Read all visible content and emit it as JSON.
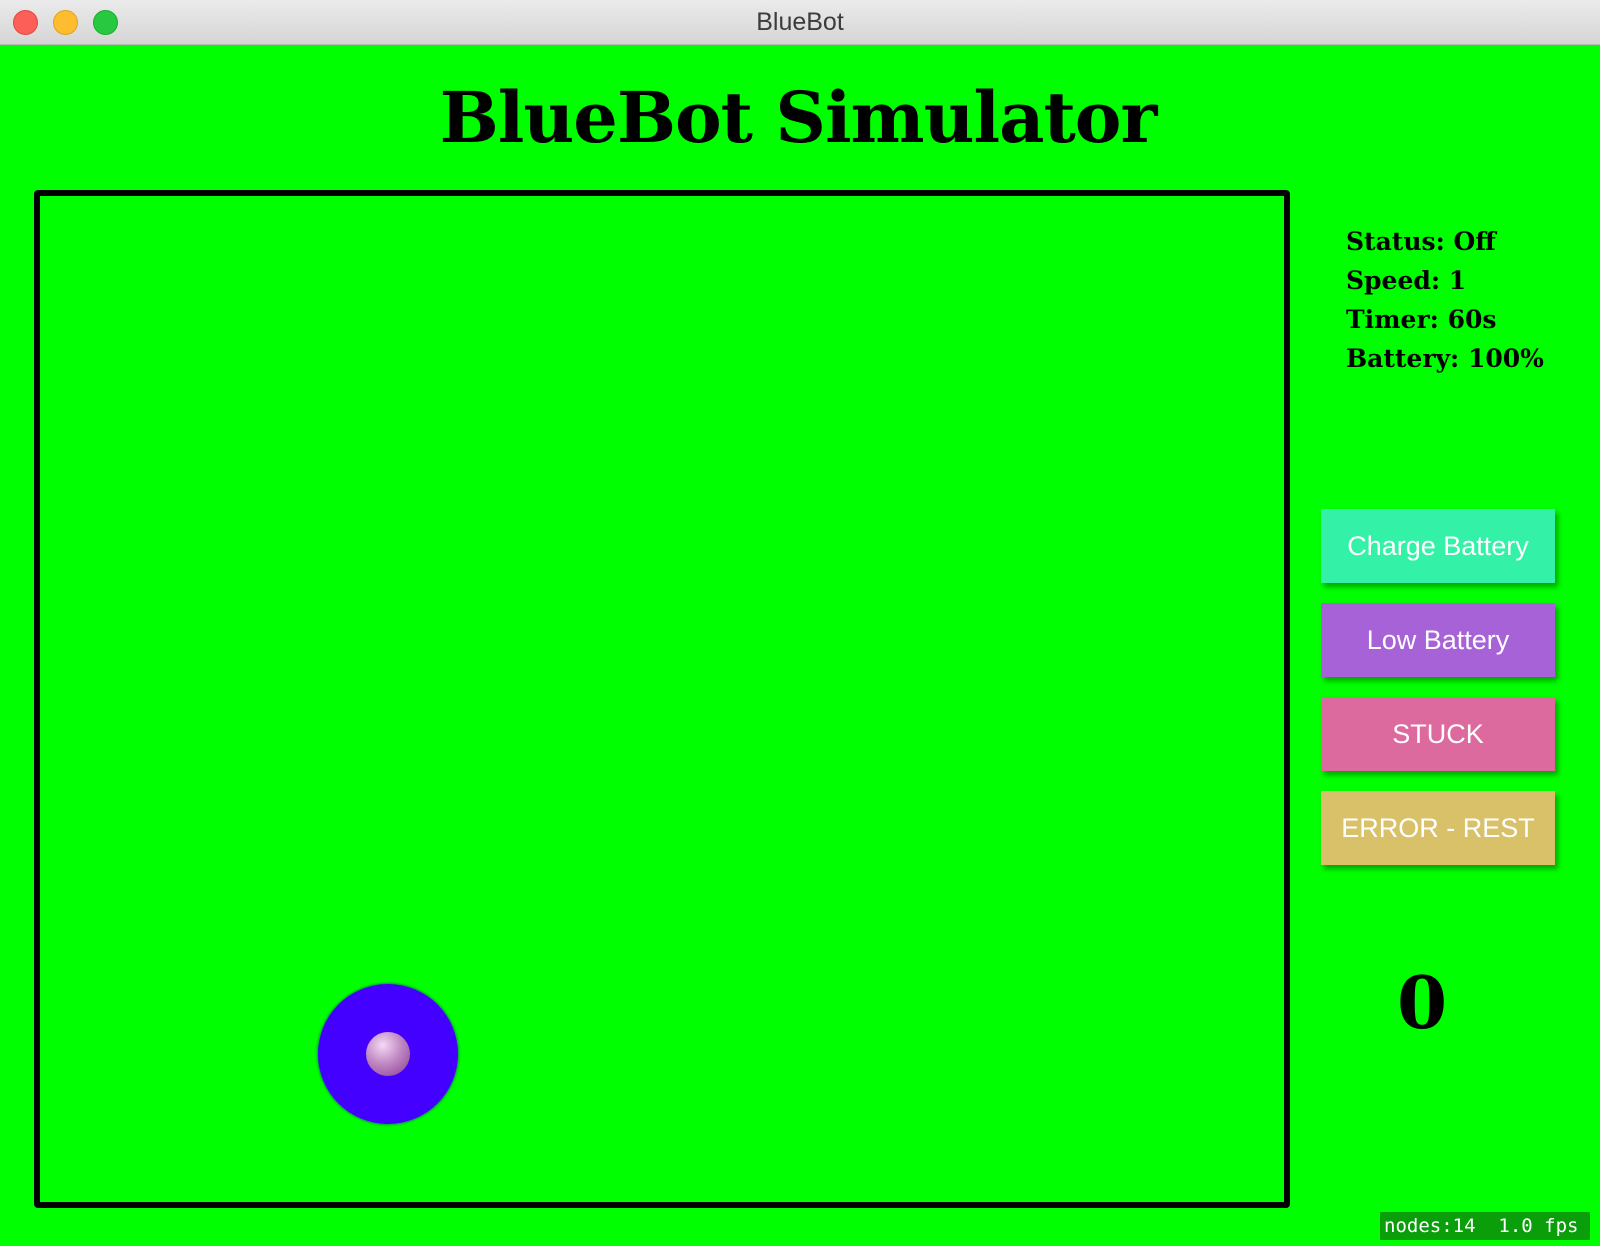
{
  "window": {
    "title": "BlueBot"
  },
  "app": {
    "title": "BlueBot Simulator"
  },
  "status": {
    "status_line": "Status: Off",
    "speed_line": "Speed: 1",
    "timer_line": "Timer: 60s",
    "battery_line": "Battery: 100%"
  },
  "controls": {
    "charge_label": "Charge Battery",
    "low_label": "Low Battery",
    "stuck_label": "STUCK",
    "error_label": "ERROR - REST"
  },
  "counter": {
    "value": "0"
  },
  "perf": {
    "text": "nodes:14  1.0 fps"
  },
  "colors": {
    "background": "#00ff00",
    "robot": "#4400ff",
    "charge_button": "#33f2a8",
    "low_button": "#a762d8",
    "stuck_button": "#dc6a9e",
    "error_button": "#d9c169"
  }
}
